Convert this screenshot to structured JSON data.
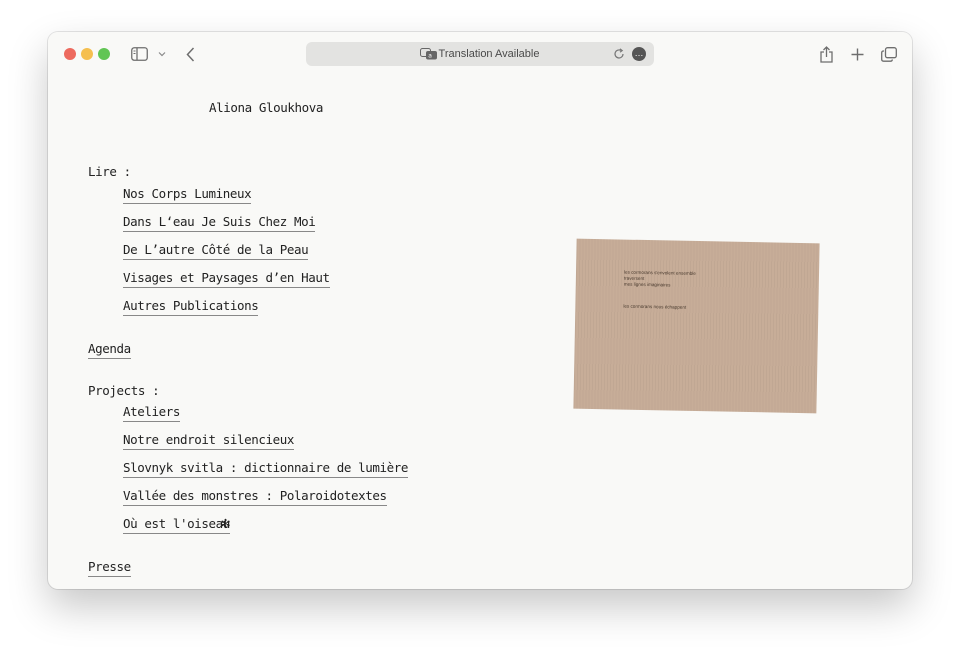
{
  "browser": {
    "address_bar": "Translation Available",
    "more_glyph": "…"
  },
  "page": {
    "site_title": "Aliona Gloukhova",
    "lire_label": "Lire :",
    "lire_items": [
      "Nos Corps Lumineux",
      "Dans L‘eau Je Suis Chez Moi",
      "De L’autre Côté de la Peau",
      "Visages et Paysages d’en Haut",
      "Autres Publications"
    ],
    "agenda": "Agenda",
    "projects_label": "Projects :",
    "project_items": [
      "Ateliers",
      "Notre endroit silencieux",
      "Slovnyk svitla : dictionnaire de lumière",
      "Vallée des monstres : Polaroidotextes",
      "Où est l'oiseau"
    ],
    "asterisk": "✻",
    "presse": "Presse",
    "image_text": [
      "les cormorans s'envolent ensemble",
      "traversent",
      "mes lignes imaginaires",
      "les cormorans nous échappent"
    ]
  }
}
